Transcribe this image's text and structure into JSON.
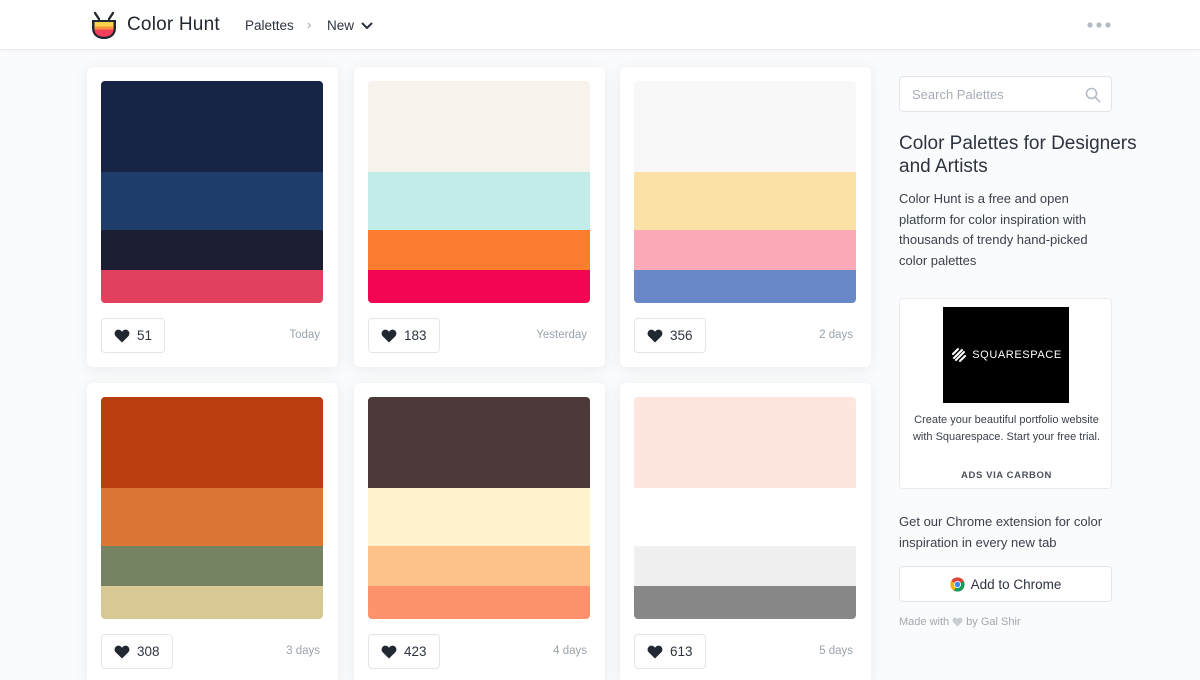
{
  "header": {
    "brand": "Color Hunt",
    "breadcrumb_root": "Palettes",
    "breadcrumb_separator": "›",
    "breadcrumb_current": "New"
  },
  "palettes": [
    {
      "colors": [
        "#172446",
        "#1f3d6a",
        "#1b1d32",
        "#e1405e"
      ],
      "likes": "51",
      "date": "Today"
    },
    {
      "colors": [
        "#f7f2ec",
        "#c2ece8",
        "#fc7d32",
        "#f40552"
      ],
      "likes": "183",
      "date": "Yesterday"
    },
    {
      "colors": [
        "#f8f8f8",
        "#fce1a7",
        "#fcaab7",
        "#6787c7"
      ],
      "likes": "356",
      "date": "2 days"
    },
    {
      "colors": [
        "#b93d0e",
        "#dc7634",
        "#758363",
        "#d8c994"
      ],
      "likes": "308",
      "date": "3 days"
    },
    {
      "colors": [
        "#4b3a39",
        "#fff2cc",
        "#fec187",
        "#fe926c"
      ],
      "likes": "423",
      "date": "4 days"
    },
    {
      "colors": [
        "#fee6df",
        "#ffffff",
        "#efefef",
        "#878787"
      ],
      "likes": "613",
      "date": "5 days"
    }
  ],
  "sidebar": {
    "search_placeholder": "Search Palettes",
    "heading": "Color Palettes for Designers and Artists",
    "description": "Color Hunt is a free and open platform for color inspiration with thousands of trendy hand-picked color palettes",
    "ad": {
      "brand": "SQUARESPACE",
      "text": "Create your beautiful portfolio website with Squarespace. Start your free trial.",
      "via": "ADS VIA CARBON"
    },
    "extension_text": "Get our Chrome extension for color inspiration in every new tab",
    "chrome_button": "Add to Chrome",
    "made_with_prefix": "Made with",
    "made_with_suffix": "by Gal Shir"
  },
  "icons": {
    "logo": "color-hunt-logo-icon",
    "more": "more-dots-icon",
    "chevron": "chevron-down-icon",
    "search": "search-icon",
    "heart": "heart-icon",
    "chrome": "chrome-icon",
    "squarespace": "squarespace-logo-icon"
  }
}
